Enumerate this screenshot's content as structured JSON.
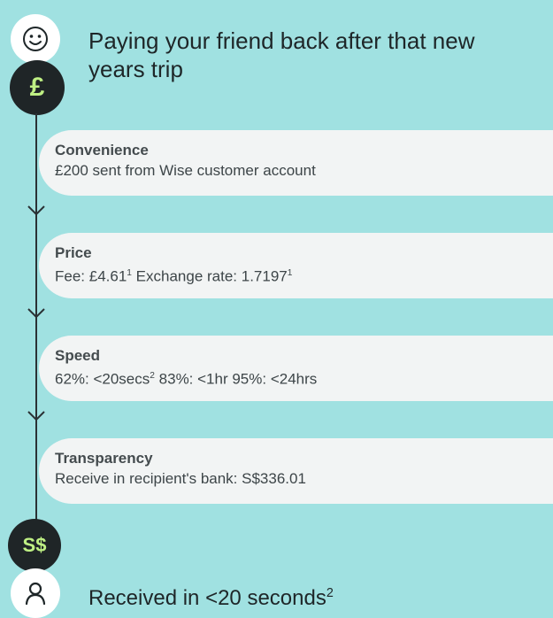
{
  "headline": "Paying your friend back after that new years trip",
  "icons": {
    "sender": "smiley-face-icon",
    "source_currency": "£",
    "target_currency": "S$",
    "recipient": "person-icon"
  },
  "cards": [
    {
      "title": "Convenience",
      "body": "£200 sent from Wise customer account"
    },
    {
      "title": "Price",
      "body_parts": [
        "Fee: £4.61",
        "1",
        " Exchange rate: 1.7197",
        "1"
      ]
    },
    {
      "title": "Speed",
      "body_parts": [
        "62%: <20secs",
        "2",
        " 83%: <1hr 95%: <24hrs"
      ]
    },
    {
      "title": "Transparency",
      "body": "Receive in recipient's bank: S$336.01"
    }
  ],
  "received": {
    "text": "Received in <20 seconds",
    "footnote": "2"
  },
  "colors": {
    "background": "#a0e1e1",
    "card": "#f2f4f4",
    "dark_circle": "#1f2527",
    "accent_green": "#bff084"
  }
}
